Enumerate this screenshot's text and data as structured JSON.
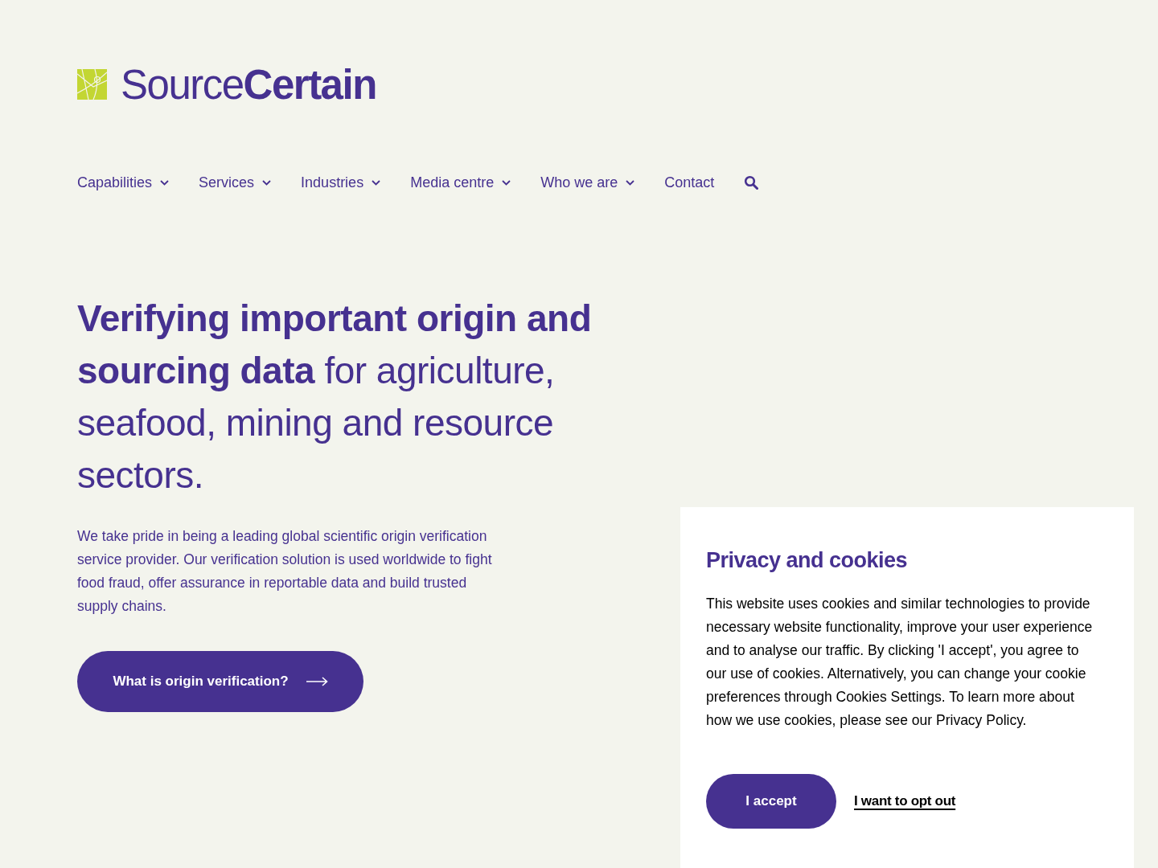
{
  "logo": {
    "wordmark": "Source**Certain**"
  },
  "nav": {
    "items": [
      {
        "label": "Capabilities",
        "has_menu": true
      },
      {
        "label": "Services",
        "has_menu": true
      },
      {
        "label": "Industries",
        "has_menu": true
      },
      {
        "label": "Media centre",
        "has_menu": true
      },
      {
        "label": "Who we are",
        "has_menu": true
      },
      {
        "label": "Contact",
        "has_menu": false
      }
    ]
  },
  "hero": {
    "headline": "**Verifying important origin and sourcing data** for agriculture, seafood, mining and resource sectors.",
    "intro": "We take pride in being a leading global scientific origin verification service provider. Our verification solution is used worldwide to fight food fraud, offer assurance in reportable data and build trusted supply chains.",
    "cta": "What is origin verification?"
  },
  "cookie_banner": {
    "title": "Privacy and cookies",
    "body": "This website uses cookies and similar technologies to provide necessary website functionality, improve your user experience and to analyse our traffic. By clicking 'I accept', you agree to our use of cookies. Alternatively, you can change your cookie preferences through Cookies Settings. To learn more about how we use cookies, please see our Privacy Policy.",
    "accept": "I accept",
    "opt_out": "I want to opt out"
  }
}
